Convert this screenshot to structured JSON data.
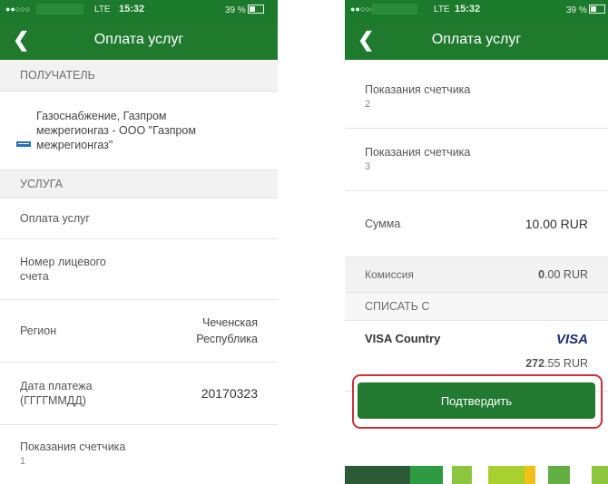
{
  "status": {
    "net": "LTE",
    "time": "15:32",
    "battery": "39 %"
  },
  "left": {
    "nav_title": "Оплата услуг",
    "recipient_header": "ПОЛУЧАТЕЛЬ",
    "recipient_name": [
      "Газоснабжение, Газпром",
      "межрегионгаз - ООО \"Газпром",
      "межрегионгаз\""
    ],
    "service_header": "УСЛУГА",
    "service_value": "Оплата услуг",
    "account_label": [
      "Номер лицевого",
      "счета"
    ],
    "region_label": "Регион",
    "region_value": [
      "Чеченская",
      "Республика"
    ],
    "date_label": [
      "Дата платежа",
      "(ГГГГММДД)"
    ],
    "date_value": "20170323",
    "meter1_label": "Показания счетчика",
    "meter1_value": "1"
  },
  "right": {
    "nav_title": "Оплата услуг",
    "meter2_label": "Показания счетчика",
    "meter2_value": "2",
    "meter3_label": "Показания счетчика",
    "meter3_value": "3",
    "sum_label": "Сумма",
    "sum_value": "10.00 RUR",
    "fee_label": "Комиссия",
    "fee_value_int": "0",
    "fee_value_rest": ".00 RUR",
    "debit_header": "СПИСАТЬ С",
    "card_name": "VISA Country",
    "card_brand": "VISA",
    "card_balance_int": "272",
    "card_balance_rest": ".55 RUR",
    "confirm_label": "Подтвердить"
  },
  "colors": {
    "brand_green": "#1f7a2e",
    "highlight_red": "#c8313a"
  }
}
